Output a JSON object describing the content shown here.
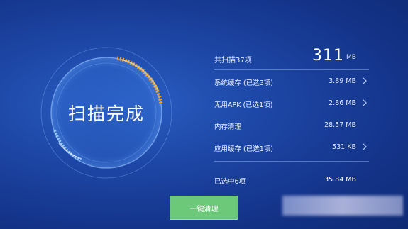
{
  "scan": {
    "status_label": "扫描完成"
  },
  "summary": {
    "total_label": "共扫描37项",
    "total_value": "311",
    "total_unit": "MB"
  },
  "items": [
    {
      "label": "系统缓存 (已选3项)",
      "value": "3.89 MB",
      "has_chevron": true
    },
    {
      "label": "无用APK (已选1项)",
      "value": "2.86 MB",
      "has_chevron": true
    },
    {
      "label": "内存清理",
      "value": "28.57 MB",
      "has_chevron": false
    },
    {
      "label": "应用缓存 (已选1项)",
      "value": "531 KB",
      "has_chevron": true
    }
  ],
  "selected": {
    "label": "已选中6项",
    "value": "35.84 MB"
  },
  "actions": {
    "clean_button_label": "一键清理"
  },
  "colors": {
    "background": "#1d47a6",
    "accent_orange": "#f0a030",
    "button_green": "#6dc97a"
  }
}
